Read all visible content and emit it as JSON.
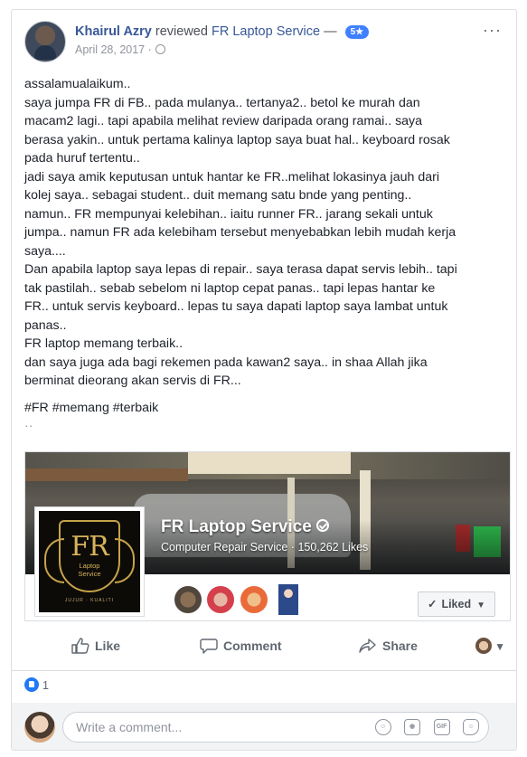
{
  "post": {
    "author": "Khairul Azry",
    "action": "reviewed",
    "page": "FR Laptop Service",
    "separator": "—",
    "rating": "5★",
    "date": "April 28, 2017 ·",
    "more": "···",
    "lines": [
      "assalamualaikum..",
      "saya jumpa FR di FB.. pada mulanya.. tertanya2.. betol ke murah dan",
      "macam2 lagi.. tapi apabila melihat review daripada orang ramai.. saya",
      "berasa yakin.. untuk pertama kalinya laptop saya buat hal.. keyboard rosak",
      "pada huruf tertentu..",
      "jadi saya amik keputusan untuk hantar ke FR..melihat lokasinya jauh dari",
      "kolej saya.. sebagai student.. duit memang satu bnde yang penting..",
      "namun.. FR mempunyai kelebihan.. iaitu runner FR.. jarang sekali untuk",
      "jumpa.. namun FR ada kelebiham tersebut menyebabkan lebih mudah kerja",
      "saya....",
      "Dan apabila laptop saya lepas di repair.. saya terasa dapat servis lebih.. tapi",
      "tak pastilah.. sebab sebelom ni laptop cepat panas.. tapi lepas hantar ke",
      "FR.. untuk servis keyboard.. lepas tu saya dapati laptop saya lambat untuk",
      "panas..",
      "FR laptop memang terbaik..",
      "dan saya juga ada bagi rekemen pada kawan2 saya.. in shaa Allah jika",
      "berminat dieorang akan servis di FR..."
    ],
    "hashtags": "#FR #memang #terbaik",
    "ellipsis": "··"
  },
  "page_card": {
    "name": "FR Laptop Service",
    "subtitle": "Computer Repair Service · 150,262 Likes",
    "logo_text": "FR",
    "logo_sub_1": "Laptop",
    "logo_sub_2": "Service",
    "logo_foot": "JUJUR · KUALITI",
    "liked_label": "Liked"
  },
  "actions": {
    "like": "Like",
    "comment": "Comment",
    "share": "Share"
  },
  "likes_count": "1",
  "comment_box": {
    "placeholder": "Write a comment..."
  },
  "colors": {
    "link": "#385898",
    "like_blue": "#2078f4",
    "rating_badge": "#4080ff"
  }
}
